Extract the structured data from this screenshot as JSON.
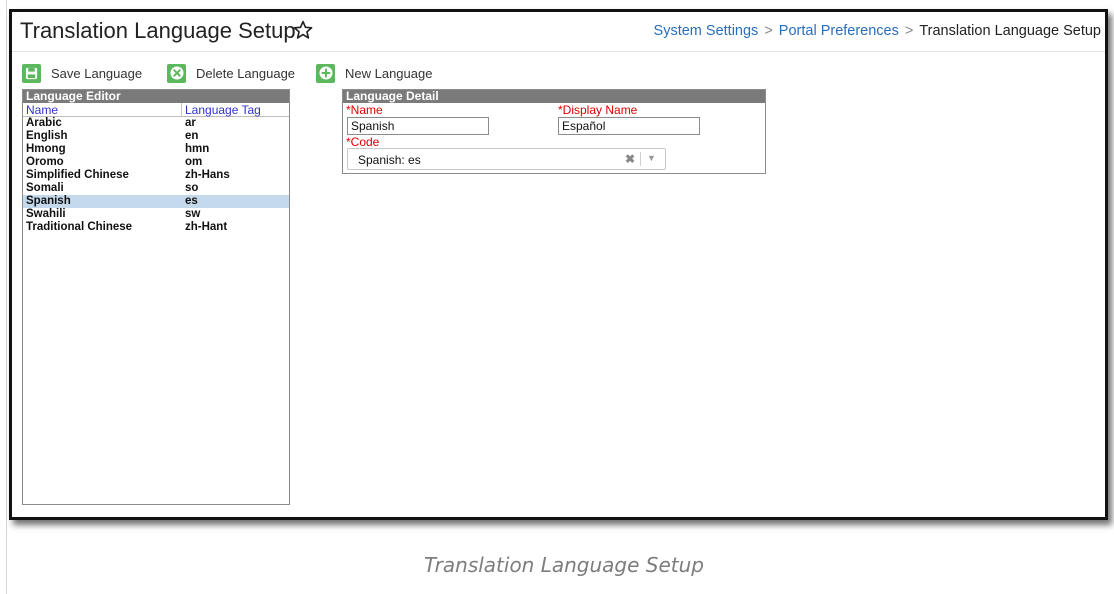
{
  "header": {
    "title": "Translation Language Setup",
    "breadcrumb": [
      "System Settings",
      "Portal Preferences",
      "Translation Language Setup"
    ],
    "breadcrumb_separator": ">"
  },
  "toolbar": {
    "save_label": "Save Language",
    "delete_label": "Delete Language",
    "new_label": "New Language"
  },
  "language_editor": {
    "title": "Language Editor",
    "columns": {
      "name": "Name",
      "tag": "Language Tag"
    },
    "rows": [
      {
        "name": "Arabic",
        "tag": "ar",
        "selected": false
      },
      {
        "name": "English",
        "tag": "en",
        "selected": false
      },
      {
        "name": "Hmong",
        "tag": "hmn",
        "selected": false
      },
      {
        "name": "Oromo",
        "tag": "om",
        "selected": false
      },
      {
        "name": "Simplified Chinese",
        "tag": "zh-Hans",
        "selected": false
      },
      {
        "name": "Somali",
        "tag": "so",
        "selected": false
      },
      {
        "name": "Spanish",
        "tag": "es",
        "selected": true
      },
      {
        "name": "Swahili",
        "tag": "sw",
        "selected": false
      },
      {
        "name": "Traditional Chinese",
        "tag": "zh-Hant",
        "selected": false
      }
    ]
  },
  "language_detail": {
    "title": "Language Detail",
    "name_label": "*Name",
    "name_value": "Spanish",
    "display_name_label": "*Display Name",
    "display_name_value": "Español",
    "code_label": "*Code",
    "code_value": "Spanish: es",
    "clear_glyph": "✖",
    "arrow_glyph": "▼"
  },
  "caption": "Translation Language Setup",
  "colors": {
    "link": "#2a6ebb",
    "required": "#e00000",
    "column_header": "#3333cc",
    "toolbar_icon": "#5cb85c",
    "panel_header": "#7a7a7a",
    "row_selected": "#c5d9ec"
  },
  "icons": {
    "star": "star-outline-icon",
    "save": "floppy-disk-icon",
    "delete": "circle-x-icon",
    "new": "circle-plus-icon"
  }
}
